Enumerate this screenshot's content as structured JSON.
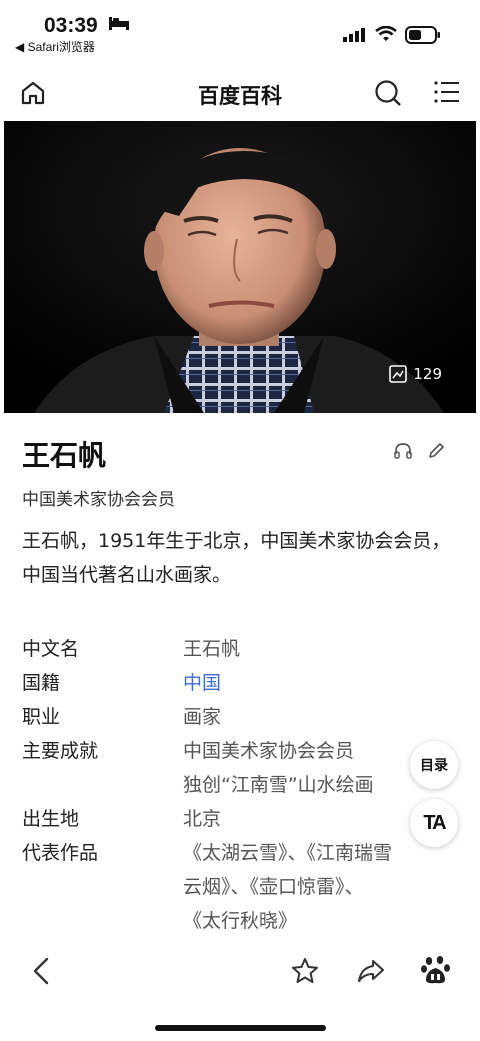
{
  "status_bar": {
    "time": "03:39",
    "back_app": "◀ Safari浏览器"
  },
  "nav": {
    "title": "百度百科"
  },
  "hero": {
    "photo_count": "129"
  },
  "entry": {
    "name": "王石帆",
    "subtitle": "中国美术家协会会员",
    "summary": "王石帆，1951年生于北京，中国美术家协会会员，中国当代著名山水画家。"
  },
  "infobox": [
    {
      "key": "中文名",
      "values": [
        "王石帆"
      ],
      "link": false
    },
    {
      "key": "国籍",
      "values": [
        "中国"
      ],
      "link": true
    },
    {
      "key": "职业",
      "values": [
        "画家"
      ],
      "link": false
    },
    {
      "key": "主要成就",
      "values": [
        "中国美术家协会会员",
        "独创“江南雪”山水绘画"
      ],
      "link": false
    },
    {
      "key": "出生地",
      "values": [
        "北京"
      ],
      "link": false
    },
    {
      "key": "代表作品",
      "values": [
        "《太湖云雪》、《江南瑞雪",
        "云烟》、《壶口惊雷》、",
        "《太行秋晓》"
      ],
      "link": false
    }
  ],
  "floating": {
    "toc_label": "目录",
    "ta_label": "TA"
  },
  "colors": {
    "link": "#3b6fd0",
    "hero_bg": "#000000"
  }
}
